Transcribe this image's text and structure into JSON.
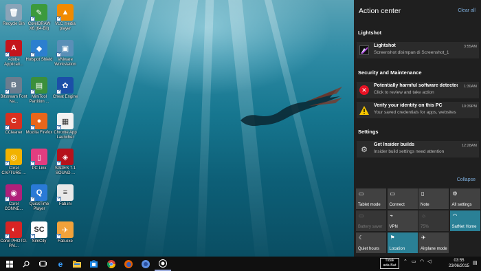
{
  "desktop": {
    "icons": [
      {
        "label": "Recycle Bin",
        "color": "#8aa4b8",
        "glyph": "🗑"
      },
      {
        "label": "CorelDRAW X6 (64-Bit)",
        "color": "#3c9a3c",
        "glyph": "✎"
      },
      {
        "label": "VLC media player",
        "color": "#f18a00",
        "glyph": "▲"
      },
      {
        "label": "Adobe Applicati...",
        "color": "#c4151c",
        "glyph": "A"
      },
      {
        "label": "Hotspot Shield",
        "color": "#2c7fcf",
        "glyph": "◆"
      },
      {
        "label": "VMware Workstation",
        "color": "#5a8fb7",
        "glyph": "▣"
      },
      {
        "label": "Bitstream Font Na...",
        "color": "#6b7d8f",
        "glyph": "B"
      },
      {
        "label": "MiniTool Partition ...",
        "color": "#3b8f3b",
        "glyph": "▤"
      },
      {
        "label": "Cheat Engine",
        "color": "#1b4fa8",
        "glyph": "✿"
      },
      {
        "label": "CCleaner",
        "color": "#d83020",
        "glyph": "C"
      },
      {
        "label": "Mozilla Firefox",
        "color": "#e8661b",
        "glyph": "●"
      },
      {
        "label": "Chrome App Launcher",
        "color": "#f2f2f2",
        "glyph": "▦"
      },
      {
        "label": "Corel CAPTURE ...",
        "color": "#f2b200",
        "glyph": "◎"
      },
      {
        "label": "PC Link",
        "color": "#e23d80",
        "glyph": "▯"
      },
      {
        "label": "SADES 7.1 SOUND ...",
        "color": "#b5121b",
        "glyph": "◈"
      },
      {
        "label": "Corel CONNE...",
        "color": "#b0207a",
        "glyph": "◉"
      },
      {
        "label": "QuickTime Player",
        "color": "#2a7ad6",
        "glyph": "Q"
      },
      {
        "label": "Fab.ini",
        "color": "#e8e8e8",
        "glyph": "≡"
      },
      {
        "label": "Corel PHOTO-PAI...",
        "color": "#d82424",
        "glyph": "◐"
      },
      {
        "label": "SimCity",
        "color": "#ffffff",
        "glyph": "SC"
      },
      {
        "label": "Fab.exe",
        "color": "#f2a23a",
        "glyph": "✈"
      }
    ]
  },
  "action_center": {
    "title": "Action center",
    "clear_all": "Clear all",
    "groups": [
      {
        "name": "Lightshot",
        "notifications": [
          {
            "title": "Lightshot",
            "body": "Screenshot disimpan di Screenshot_1",
            "time": "3:55AM",
            "icon": "lightshot-icon"
          }
        ]
      },
      {
        "name": "Security and Maintenance",
        "notifications": [
          {
            "title": "Potentially harmful software detected",
            "body": "Click to review and take action",
            "time": "1:30AM",
            "icon": "error-icon"
          },
          {
            "title": "Verify your identity on this PC",
            "body": "Your saved credentials for apps, websites",
            "time": "10:39PM",
            "icon": "warning-icon"
          }
        ]
      },
      {
        "name": "Settings",
        "notifications": [
          {
            "title": "Get Insider builds",
            "body": "Insider build settings need attention",
            "time": "12:28AM",
            "icon": "gear-icon"
          }
        ]
      }
    ],
    "collapse": "Collapse",
    "quick_actions": [
      {
        "label": "Tablet mode",
        "icon": "▭",
        "state": "off"
      },
      {
        "label": "Connect",
        "icon": "▭",
        "state": "off"
      },
      {
        "label": "Note",
        "icon": "▯",
        "state": "off"
      },
      {
        "label": "All settings",
        "icon": "⚙",
        "state": "off"
      },
      {
        "label": "Battery saver",
        "icon": "▭",
        "state": "disabled"
      },
      {
        "label": "VPN",
        "icon": "⌁",
        "state": "off"
      },
      {
        "label": "75%",
        "icon": "☼",
        "state": "disabled"
      },
      {
        "label": "SatNet Home",
        "icon": "◠",
        "state": "on"
      },
      {
        "label": "Quiet hours",
        "icon": "☾",
        "state": "off"
      },
      {
        "label": "Location",
        "icon": "⚑",
        "state": "on"
      },
      {
        "label": "Airplane mode",
        "icon": "✈",
        "state": "off"
      }
    ]
  },
  "taskbar": {
    "language": [
      "Tidak",
      "ada Bat"
    ],
    "time": "03:55",
    "date": "23/06/2015"
  },
  "colors": {
    "accent": "#2a8096",
    "link": "#7fb1e0",
    "panel": "#1f1f1f"
  }
}
